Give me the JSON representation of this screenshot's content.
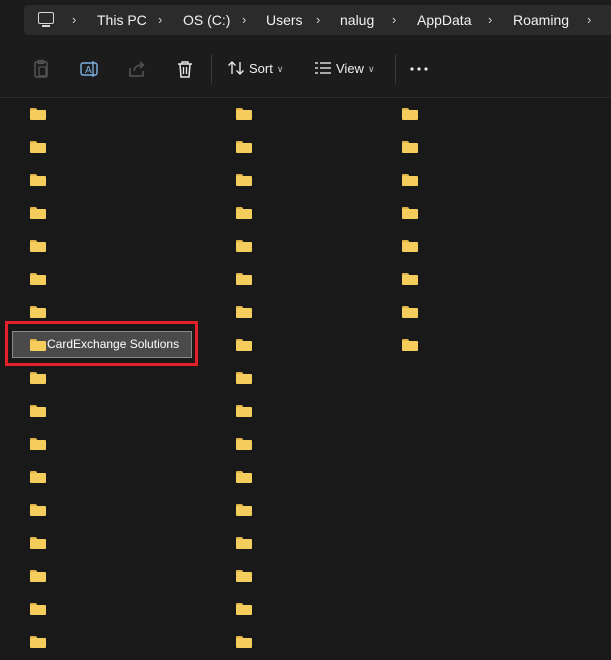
{
  "breadcrumb": {
    "items": [
      "This PC",
      "OS (C:)",
      "Users",
      "nalug",
      "AppData",
      "Roaming"
    ]
  },
  "toolbar": {
    "sort_label": "Sort",
    "view_label": "View"
  },
  "selected_folder": {
    "name": "CardExchange Solutions"
  },
  "folder_columns": {
    "col1_count": 17,
    "col2_count": 17,
    "col3_count": 8
  },
  "colors": {
    "background": "#191919",
    "folder": "#f5cd5c",
    "highlight": "#e5202a"
  }
}
